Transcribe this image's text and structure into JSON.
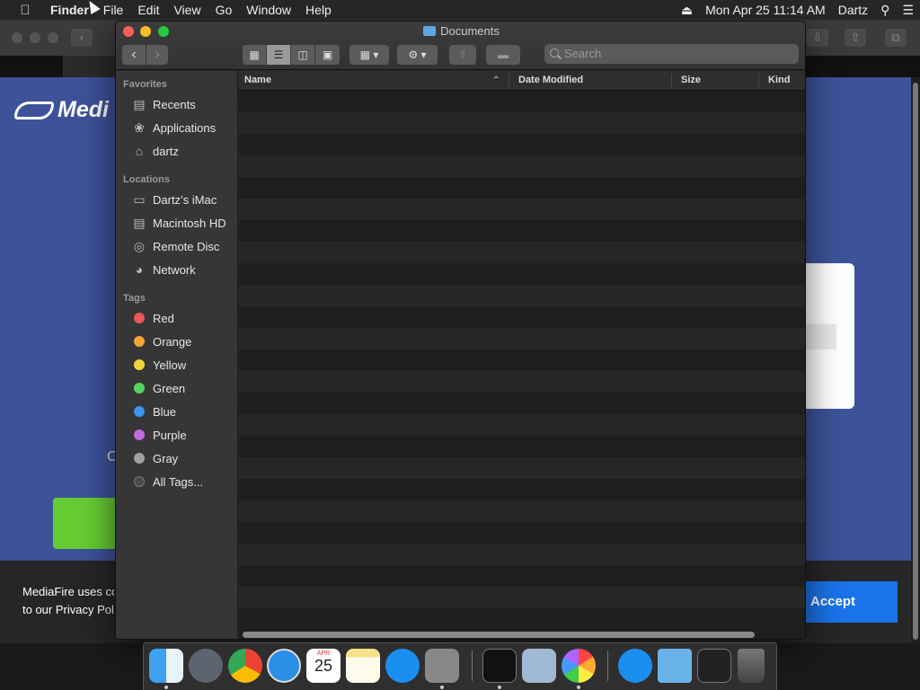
{
  "menubar": {
    "app": "Finder",
    "items": [
      "File",
      "Edit",
      "View",
      "Go",
      "Window",
      "Help"
    ],
    "clock": "Mon Apr 25  11:14 AM",
    "user": "Dartz"
  },
  "browser": {
    "logo_text": "Medi",
    "cut_text": "C",
    "cookie_text_1": "MediaFire uses co",
    "cookie_text_2": "to our Privacy Pol",
    "accept_label": "Accept"
  },
  "finder": {
    "title": "Documents",
    "search_placeholder": "Search",
    "sidebar": {
      "favorites_header": "Favorites",
      "favorites": [
        {
          "label": "Recents",
          "icon": "recents-icon"
        },
        {
          "label": "Applications",
          "icon": "applications-icon"
        },
        {
          "label": "dartz",
          "icon": "home-icon"
        }
      ],
      "locations_header": "Locations",
      "locations": [
        {
          "label": "Dartz’s iMac",
          "icon": "imac-icon"
        },
        {
          "label": "Macintosh HD",
          "icon": "hard-drive-icon"
        },
        {
          "label": "Remote Disc",
          "icon": "disc-icon"
        },
        {
          "label": "Network",
          "icon": "network-icon"
        }
      ],
      "tags_header": "Tags",
      "tags": [
        {
          "label": "Red",
          "color": "#ec5757"
        },
        {
          "label": "Orange",
          "color": "#f5a534"
        },
        {
          "label": "Yellow",
          "color": "#f3d538"
        },
        {
          "label": "Green",
          "color": "#55d462"
        },
        {
          "label": "Blue",
          "color": "#3b94ef"
        },
        {
          "label": "Purple",
          "color": "#c06bdc"
        },
        {
          "label": "Gray",
          "color": "#a0a0a0"
        },
        {
          "label": "All Tags...",
          "color": "#4a4a4a"
        }
      ]
    },
    "columns": {
      "name": "Name",
      "date_modified": "Date Modified",
      "size": "Size",
      "kind": "Kind"
    }
  },
  "dock": {
    "calendar_month": "APR",
    "calendar_day": "25",
    "apps": [
      "finder-icon",
      "launchpad-icon",
      "chrome-icon",
      "safari-icon",
      "calendar-icon",
      "notes-icon",
      "app-store-icon",
      "system-preferences-icon",
      "terminal-icon",
      "preview-icon",
      "photos-icon",
      "downloads-stack-icon",
      "documents-folder-icon",
      "screenshot-stack-icon",
      "trash-icon"
    ]
  }
}
